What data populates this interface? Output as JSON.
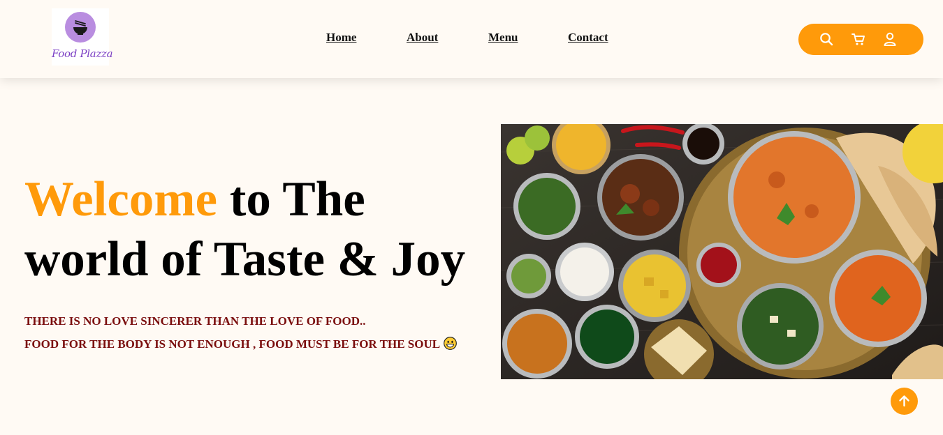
{
  "brand": {
    "name": "Food Plazza",
    "logo_icon": "bowl-chopsticks-icon",
    "logo_color": "#b98de0",
    "text_color": "#7b3fc4"
  },
  "nav": {
    "items": [
      {
        "label": "Home"
      },
      {
        "label": "About"
      },
      {
        "label": "Menu"
      },
      {
        "label": "Contact"
      }
    ]
  },
  "actions": {
    "icons": [
      "search-icon",
      "cart-icon",
      "user-icon"
    ],
    "background": "#ff9a0a"
  },
  "hero": {
    "title_accent": "Welcome",
    "title_rest": " to The world of Taste & Joy",
    "tagline_1": "THERE IS NO LOVE SINCERER THAN THE LOVE OF FOOD..",
    "tagline_2": "FOOD FOR THE BODY IS NOT ENOUGH , FOOD MUST BE FOR THE SOUL",
    "tagline_emoji": "grinning-face-emoji",
    "accent_color": "#ff9a0a",
    "tagline_color": "#7a0d0d"
  },
  "scroll_top": {
    "icon": "arrow-up-icon"
  }
}
